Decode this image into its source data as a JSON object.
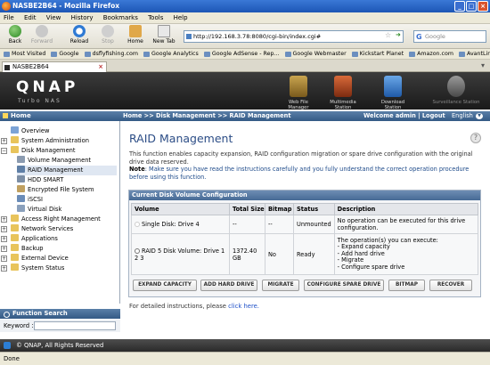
{
  "window": {
    "title": "NASBE2B64 - Mozilla Firefox"
  },
  "menu": [
    "File",
    "Edit",
    "View",
    "History",
    "Bookmarks",
    "Tools",
    "Help"
  ],
  "toolbar": {
    "back": "Back",
    "forward": "Forward",
    "reload": "Reload",
    "stop": "Stop",
    "home": "Home",
    "new_tab": "New Tab",
    "url": "http://192.168.3.78:8080/cgi-bin/index.cgi#",
    "search_placeholder": "Google"
  },
  "bookmarks": [
    "Most Visited",
    "Google",
    "dsflyfishing.com",
    "Google Analytics",
    "Google AdSense - Rep...",
    "Google Webmaster",
    "Kickstart Planet",
    "Amazon.com",
    "AvantLink Affiliate Ma..."
  ],
  "tab": {
    "label": "NASBE2B64"
  },
  "header": {
    "logo": "QNAP",
    "subtitle": "Turbo NAS",
    "stations": [
      "Web File Manager",
      "Multimedia Station",
      "Download Station",
      "Surveillance Station"
    ]
  },
  "left": {
    "home_label": "Home",
    "nav": [
      {
        "label": "Overview"
      },
      {
        "label": "System Administration"
      },
      {
        "label": "Disk Management"
      },
      {
        "label": "Volume Management"
      },
      {
        "label": "RAID Management"
      },
      {
        "label": "HDD SMART"
      },
      {
        "label": "Encrypted File System"
      },
      {
        "label": "iSCSI"
      },
      {
        "label": "Virtual Disk"
      },
      {
        "label": "Access Right Management"
      },
      {
        "label": "Network Services"
      },
      {
        "label": "Applications"
      },
      {
        "label": "Backup"
      },
      {
        "label": "External Device"
      },
      {
        "label": "System Status"
      }
    ],
    "function_search": "Function Search",
    "keyword_label": "Keyword :"
  },
  "crumbbar": {
    "breadcrumb": "Home >> Disk Management >> RAID Management",
    "welcome": "Welcome admin | Logout",
    "language": "English"
  },
  "main": {
    "title": "RAID Management",
    "description": "This function enables capacity expansion, RAID configuration migration or spare drive configuration with the original drive data reserved.",
    "note_label": "Note",
    "note_text": ": Make sure you have read the instructions carefully and you fully understand the correct operation procedure before using this function.",
    "panel_title": "Current Disk Volume Configuration",
    "columns": [
      "Volume",
      "Total Size",
      "Bitmap",
      "Status",
      "Description"
    ],
    "rows": [
      {
        "volume": "Single Disk: Drive 4",
        "size": "--",
        "bitmap": "--",
        "status": "Unmounted",
        "description": "No operation can be executed for this drive configuration."
      },
      {
        "volume": "RAID 5 Disk Volume: Drive 1 2 3",
        "size": "1372.40 GB",
        "bitmap": "No",
        "status": "Ready",
        "description": "The operation(s) you can execute:\n - Expand capacity\n - Add hard drive\n - Migrate\n - Configure spare drive"
      }
    ],
    "buttons": [
      "EXPAND CAPACITY",
      "ADD HARD DRIVE",
      "MIGRATE",
      "CONFIGURE SPARE DRIVE",
      "BITMAP",
      "RECOVER"
    ],
    "instructions": "For detailed instructions, please",
    "instructions_link": "click here."
  },
  "footer": {
    "copyright": "© QNAP, All Rights Reserved"
  },
  "statusbar": {
    "text": "Done"
  }
}
